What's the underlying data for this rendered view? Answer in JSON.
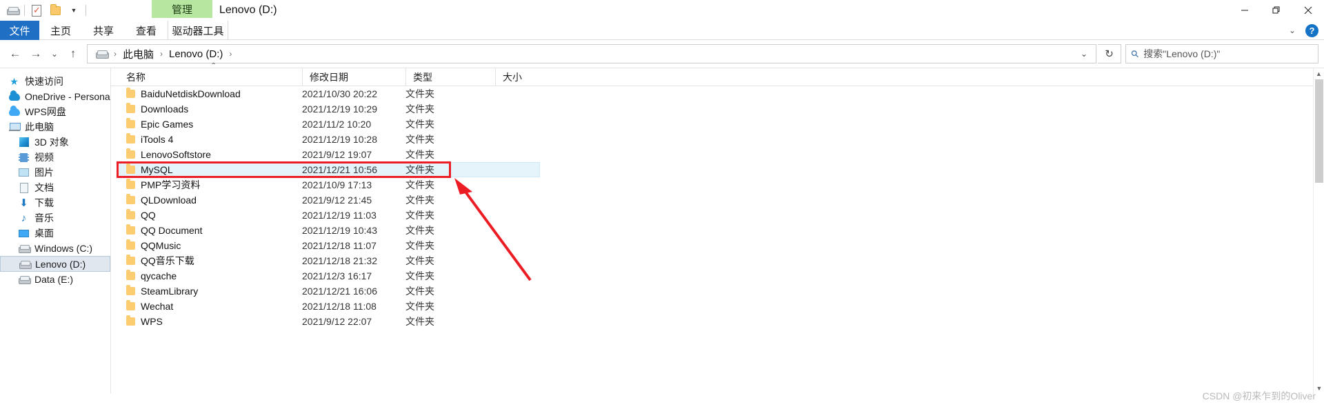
{
  "window": {
    "title": "Lenovo (D:)",
    "context_tab_group": "管理",
    "controls": {
      "minimize": "minimize-icon",
      "restore": "restore-icon",
      "close": "close-icon"
    }
  },
  "quick_access_toolbar": {
    "items": [
      {
        "name": "drive-icon",
        "label": ""
      },
      {
        "name": "properties-icon",
        "label": ""
      },
      {
        "name": "new-folder-icon",
        "label": ""
      },
      {
        "name": "customize-caret-icon",
        "label": "▾"
      }
    ]
  },
  "ribbon": {
    "tabs": [
      {
        "label": "文件",
        "active": true
      },
      {
        "label": "主页",
        "active": false
      },
      {
        "label": "共享",
        "active": false
      },
      {
        "label": "查看",
        "active": false
      },
      {
        "label": "驱动器工具",
        "active": false,
        "contextual": true
      }
    ],
    "collapse_caret": "⌄",
    "help_label": "?"
  },
  "navigation": {
    "back": "←",
    "forward": "→",
    "recent": "⌄",
    "up": "↑",
    "breadcrumb": [
      {
        "label": "",
        "icon": "drive-icon"
      },
      {
        "label": "此电脑"
      },
      {
        "label": "Lenovo (D:)"
      }
    ],
    "breadcrumb_separator": "›",
    "address_dropdown": "⌄",
    "refresh": "↻"
  },
  "search": {
    "placeholder": "搜索\"Lenovo (D:)\"",
    "icon": "search-icon"
  },
  "sidebar": {
    "items": [
      {
        "label": "快速访问",
        "icon": "star-icon",
        "indent": 0,
        "selected": false
      },
      {
        "label": "OneDrive - Persona",
        "icon": "onedrive-cloud-icon",
        "indent": 0,
        "selected": false
      },
      {
        "label": "WPS网盘",
        "icon": "wps-cloud-icon",
        "indent": 0,
        "selected": false
      },
      {
        "label": "此电脑",
        "icon": "this-pc-icon",
        "indent": 0,
        "selected": false
      },
      {
        "label": "3D 对象",
        "icon": "3d-objects-icon",
        "indent": 1,
        "selected": false
      },
      {
        "label": "视频",
        "icon": "videos-icon",
        "indent": 1,
        "selected": false
      },
      {
        "label": "图片",
        "icon": "pictures-icon",
        "indent": 1,
        "selected": false
      },
      {
        "label": "文档",
        "icon": "documents-icon",
        "indent": 1,
        "selected": false
      },
      {
        "label": "下载",
        "icon": "downloads-icon",
        "indent": 1,
        "selected": false
      },
      {
        "label": "音乐",
        "icon": "music-icon",
        "indent": 1,
        "selected": false
      },
      {
        "label": "桌面",
        "icon": "desktop-icon",
        "indent": 1,
        "selected": false
      },
      {
        "label": "Windows (C:)",
        "icon": "drive-icon",
        "indent": 1,
        "selected": false
      },
      {
        "label": "Lenovo (D:)",
        "icon": "drive-icon",
        "indent": 1,
        "selected": true
      },
      {
        "label": "Data (E:)",
        "icon": "drive-icon",
        "indent": 1,
        "selected": false
      }
    ]
  },
  "file_list": {
    "columns": [
      {
        "label": "名称",
        "sorted": "asc",
        "sort_caret": "⌃"
      },
      {
        "label": "修改日期",
        "sorted": ""
      },
      {
        "label": "类型",
        "sorted": ""
      },
      {
        "label": "大小",
        "sorted": ""
      }
    ],
    "rows": [
      {
        "name": "BaiduNetdiskDownload",
        "date": "2021/10/30 20:22",
        "type": "文件夹",
        "size": "",
        "icon": "folder-icon",
        "selected": false
      },
      {
        "name": "Downloads",
        "date": "2021/12/19 10:29",
        "type": "文件夹",
        "size": "",
        "icon": "folder-icon",
        "selected": false
      },
      {
        "name": "Epic Games",
        "date": "2021/11/2 10:20",
        "type": "文件夹",
        "size": "",
        "icon": "folder-icon",
        "selected": false
      },
      {
        "name": "iTools 4",
        "date": "2021/12/19 10:28",
        "type": "文件夹",
        "size": "",
        "icon": "folder-icon",
        "selected": false
      },
      {
        "name": "LenovoSoftstore",
        "date": "2021/9/12 19:07",
        "type": "文件夹",
        "size": "",
        "icon": "folder-icon",
        "selected": false
      },
      {
        "name": "MySQL",
        "date": "2021/12/21 10:56",
        "type": "文件夹",
        "size": "",
        "icon": "folder-icon",
        "selected": true
      },
      {
        "name": "PMP学习资料",
        "date": "2021/10/9 17:13",
        "type": "文件夹",
        "size": "",
        "icon": "folder-icon",
        "selected": false
      },
      {
        "name": "QLDownload",
        "date": "2021/9/12 21:45",
        "type": "文件夹",
        "size": "",
        "icon": "folder-icon",
        "selected": false
      },
      {
        "name": "QQ",
        "date": "2021/12/19 11:03",
        "type": "文件夹",
        "size": "",
        "icon": "folder-icon",
        "selected": false
      },
      {
        "name": "QQ Document",
        "date": "2021/12/19 10:43",
        "type": "文件夹",
        "size": "",
        "icon": "folder-icon",
        "selected": false
      },
      {
        "name": "QQMusic",
        "date": "2021/12/18 11:07",
        "type": "文件夹",
        "size": "",
        "icon": "folder-icon",
        "selected": false
      },
      {
        "name": "QQ音乐下载",
        "date": "2021/12/18 21:32",
        "type": "文件夹",
        "size": "",
        "icon": "folder-icon",
        "selected": false
      },
      {
        "name": "qycache",
        "date": "2021/12/3 16:17",
        "type": "文件夹",
        "size": "",
        "icon": "folder-icon",
        "selected": false
      },
      {
        "name": "SteamLibrary",
        "date": "2021/12/21 16:06",
        "type": "文件夹",
        "size": "",
        "icon": "folder-icon",
        "selected": false
      },
      {
        "name": "Wechat",
        "date": "2021/12/18 11:08",
        "type": "文件夹",
        "size": "",
        "icon": "folder-icon",
        "selected": false
      },
      {
        "name": "WPS",
        "date": "2021/9/12 22:07",
        "type": "文件夹",
        "size": "",
        "icon": "folder-icon",
        "selected": false
      }
    ]
  },
  "annotations": {
    "highlight_color": "#ec1c24",
    "arrow": "red-arrow-annotation",
    "highlight_target_row": "MySQL"
  },
  "watermark": {
    "text": "CSDN @初来乍到的Oliver"
  }
}
